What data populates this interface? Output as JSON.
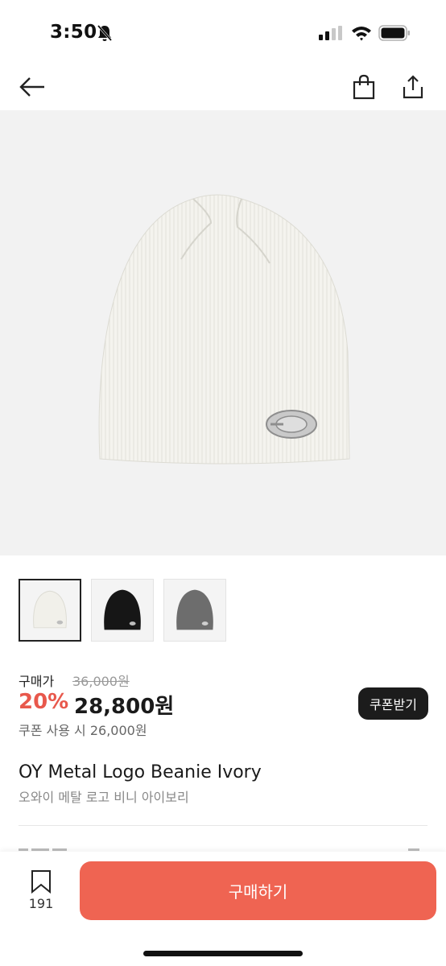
{
  "status_bar": {
    "time": "3:50",
    "icons": [
      "bell-slash-icon",
      "cellular-signal-icon",
      "wifi-icon",
      "battery-icon"
    ]
  },
  "nav": {
    "icons": [
      "back-arrow-icon",
      "shopping-bag-icon",
      "share-icon"
    ]
  },
  "gallery": {
    "thumbnails": [
      {
        "color_name": "ivory",
        "hex": "#f1f0ea"
      },
      {
        "color_name": "black",
        "hex": "#161616"
      },
      {
        "color_name": "grey",
        "hex": "#6d6d6d"
      }
    ],
    "selected_index": 0
  },
  "price": {
    "label": "구매가",
    "original": "36,000원",
    "discount": "20%",
    "sale": "28,800원",
    "coupon_text": "쿠폰 사용 시 26,000원",
    "coupon_button": "쿠폰받기"
  },
  "product": {
    "name": "OY Metal Logo Beanie Ivory",
    "name_kr": "오와이 메탈 로고 비니 아이보리"
  },
  "bottom_bar": {
    "wish_count": "191",
    "buy_label": "구매하기"
  },
  "colors": {
    "accent": "#ef6452",
    "discount": "#e8584c",
    "dark_button": "#1c1c1c"
  }
}
